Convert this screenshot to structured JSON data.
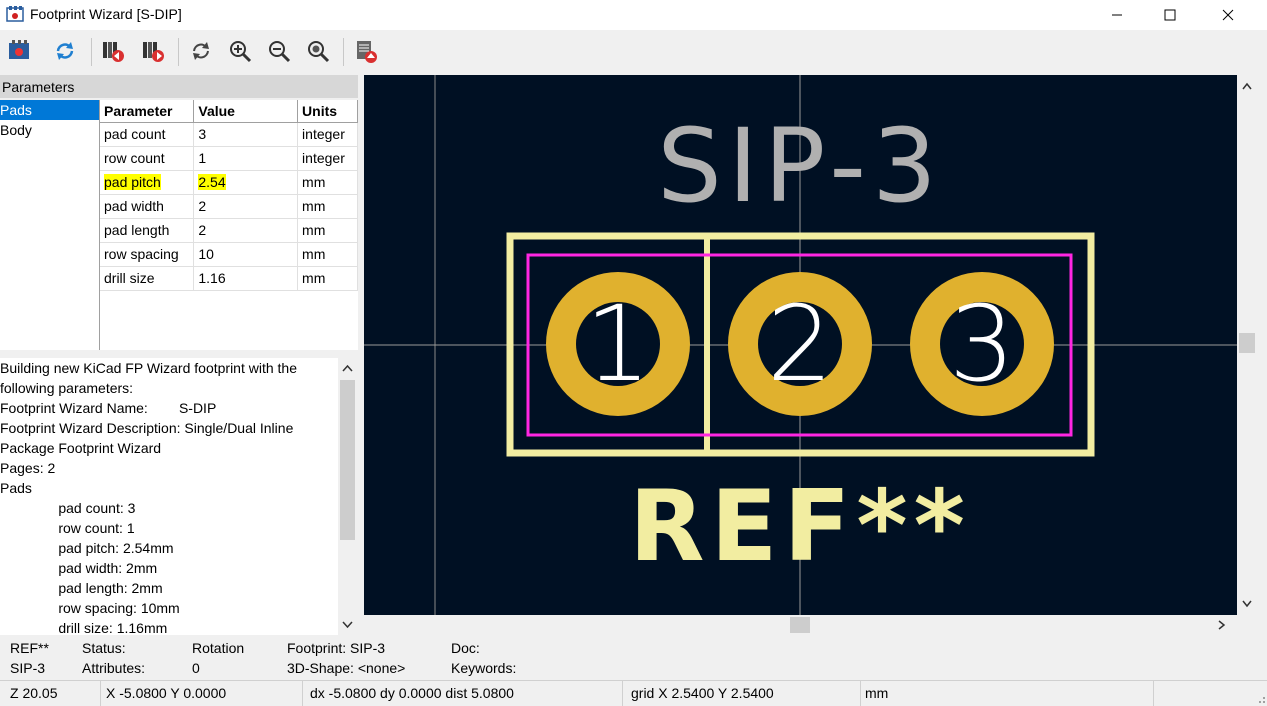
{
  "window": {
    "title": "Footprint Wizard [S-DIP]"
  },
  "toolbar": {
    "buttons": [
      "select-wizard-icon",
      "reset-parameters-icon",
      "previous-page-icon",
      "next-page-icon",
      "redraw-icon",
      "zoom-in-icon",
      "zoom-out-icon",
      "zoom-fit-icon",
      "export-footprint-icon"
    ]
  },
  "params": {
    "header": "Parameters",
    "pages": [
      "Pads",
      "Body"
    ],
    "selected_page": "Pads",
    "columns": [
      "Parameter",
      "Value",
      "Units"
    ],
    "rows": [
      [
        "pad count",
        "3",
        "integer"
      ],
      [
        "row count",
        "1",
        "integer"
      ],
      [
        "pad pitch",
        "2.54",
        "mm"
      ],
      [
        "pad width",
        "2",
        "mm"
      ],
      [
        "pad length",
        "2",
        "mm"
      ],
      [
        "row spacing",
        "10",
        "mm"
      ],
      [
        "drill size",
        "1.16",
        "mm"
      ]
    ],
    "highlighted_row": "pad pitch"
  },
  "log": {
    "lines": [
      "Building new KiCad FP Wizard footprint with the",
      "following parameters:",
      "Footprint Wizard Name:        S-DIP",
      "Footprint Wizard Description: Single/Dual Inline",
      "Package Footprint Wizard",
      "Pages: 2",
      "Pads",
      "               pad count: 3",
      "               row count: 1",
      "               pad pitch: 2.54mm",
      "               pad width: 2mm",
      "               pad length: 2mm",
      "               row spacing: 10mm",
      "               drill size: 1.16mm"
    ]
  },
  "canvas": {
    "value_text": "SIP-3",
    "ref_text": "REF**",
    "pad_numbers": [
      "1",
      "2",
      "3"
    ],
    "colors": {
      "background": "#001023",
      "silk": "#f2eda1",
      "courtyard": "#ff26e2",
      "pad": "#e0b12e",
      "fab": "#b0b0b0"
    }
  },
  "info": {
    "ref": "REF**",
    "value": "SIP-3",
    "status_label": "Status:",
    "attributes_label": "Attributes:",
    "rotation_label": "Rotation",
    "rotation_value": "0",
    "footprint": "Footprint: SIP-3",
    "shape3d": "3D-Shape: <none>",
    "doc_label": "Doc:",
    "keywords_label": "Keywords:"
  },
  "statusbar": {
    "zoom": "Z 20.05",
    "cursor": "X -5.0800  Y 0.0000",
    "delta": "dx -5.0800  dy 0.0000  dist 5.0800",
    "grid": "grid X 2.5400  Y 2.5400",
    "units": "mm"
  }
}
